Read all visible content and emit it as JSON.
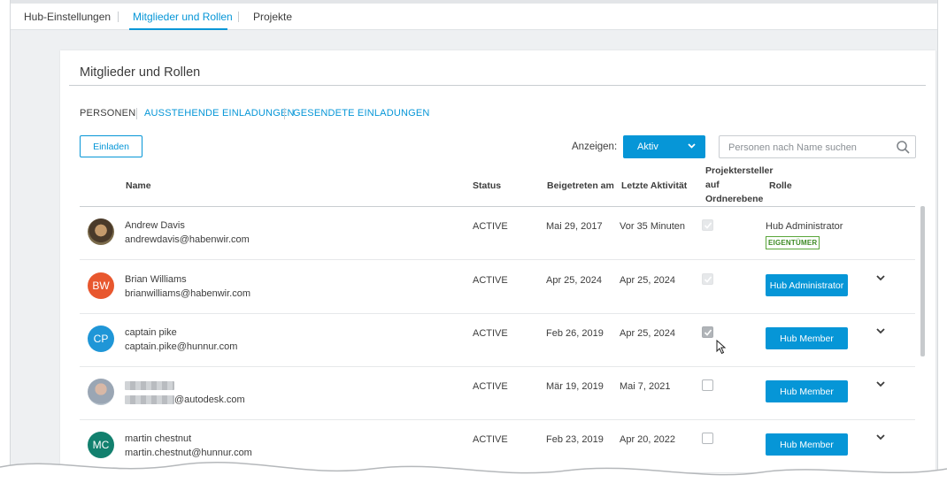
{
  "topnav": {
    "tabs": [
      {
        "label": "Hub-Einstellungen"
      },
      {
        "label": "Mitglieder und Rollen"
      },
      {
        "label": "Projekte"
      }
    ],
    "active_tab": "Mitglieder und Rollen"
  },
  "panel": {
    "title": "Mitglieder und Rollen",
    "subtabs": [
      {
        "label": "PERSONEN"
      },
      {
        "label": "AUSSTEHENDE EINLADUNGEN"
      },
      {
        "label": "GESENDETE EINLADUNGEN"
      }
    ],
    "invite_button": "Einladen",
    "filter_label": "Anzeigen:",
    "filter_value": "Aktiv",
    "search_placeholder": "Personen nach Name suchen"
  },
  "table": {
    "columns": {
      "name": "Name",
      "status": "Status",
      "joined": "Beigetreten am",
      "last_activity": "Letzte Aktivität",
      "project_creator": "Projektersteller auf Ordnerebene",
      "role": "Rolle"
    },
    "rows": [
      {
        "name": "Andrew Davis",
        "email": "andrewdavis@habenwir.com",
        "avatar": "photo",
        "status": "ACTIVE",
        "joined": "Mai 29, 2017",
        "last_activity": "Vor 35 Minuten",
        "project_creator": "checked-disabled",
        "role": "Hub Administrator",
        "badge": "EIGENTÜMER"
      },
      {
        "name": "Brian Williams",
        "email": "brianwilliams@habenwir.com",
        "avatar_initials": "BW",
        "avatar_color": "#e8572e",
        "status": "ACTIVE",
        "joined": "Apr 25, 2024",
        "last_activity": "Apr 25, 2024",
        "project_creator": "checked-disabled",
        "role": "Hub Administrator"
      },
      {
        "name": "captain pike",
        "email": "captain.pike@hunnur.com",
        "avatar_initials": "CP",
        "avatar_color": "#1f96d7",
        "status": "ACTIVE",
        "joined": "Feb 26, 2019",
        "last_activity": "Apr 25, 2024",
        "project_creator": "checked",
        "role": "Hub Member"
      },
      {
        "name": "",
        "email": "@autodesk.com",
        "avatar": "photo-blurred",
        "status": "ACTIVE",
        "joined": "Mär 19, 2019",
        "last_activity": "Mai 7, 2021",
        "project_creator": "unchecked",
        "role": "Hub Member"
      },
      {
        "name": "martin chestnut",
        "email": "martin.chestnut@hunnur.com",
        "avatar_initials": "MC",
        "avatar_color": "#12806e",
        "status": "ACTIVE",
        "joined": "Feb 23, 2019",
        "last_activity": "Apr 20, 2022",
        "project_creator": "unchecked",
        "role": "Hub Member"
      }
    ]
  },
  "colors": {
    "accent": "#0696d7",
    "owner_badge": "#3d8a25"
  }
}
